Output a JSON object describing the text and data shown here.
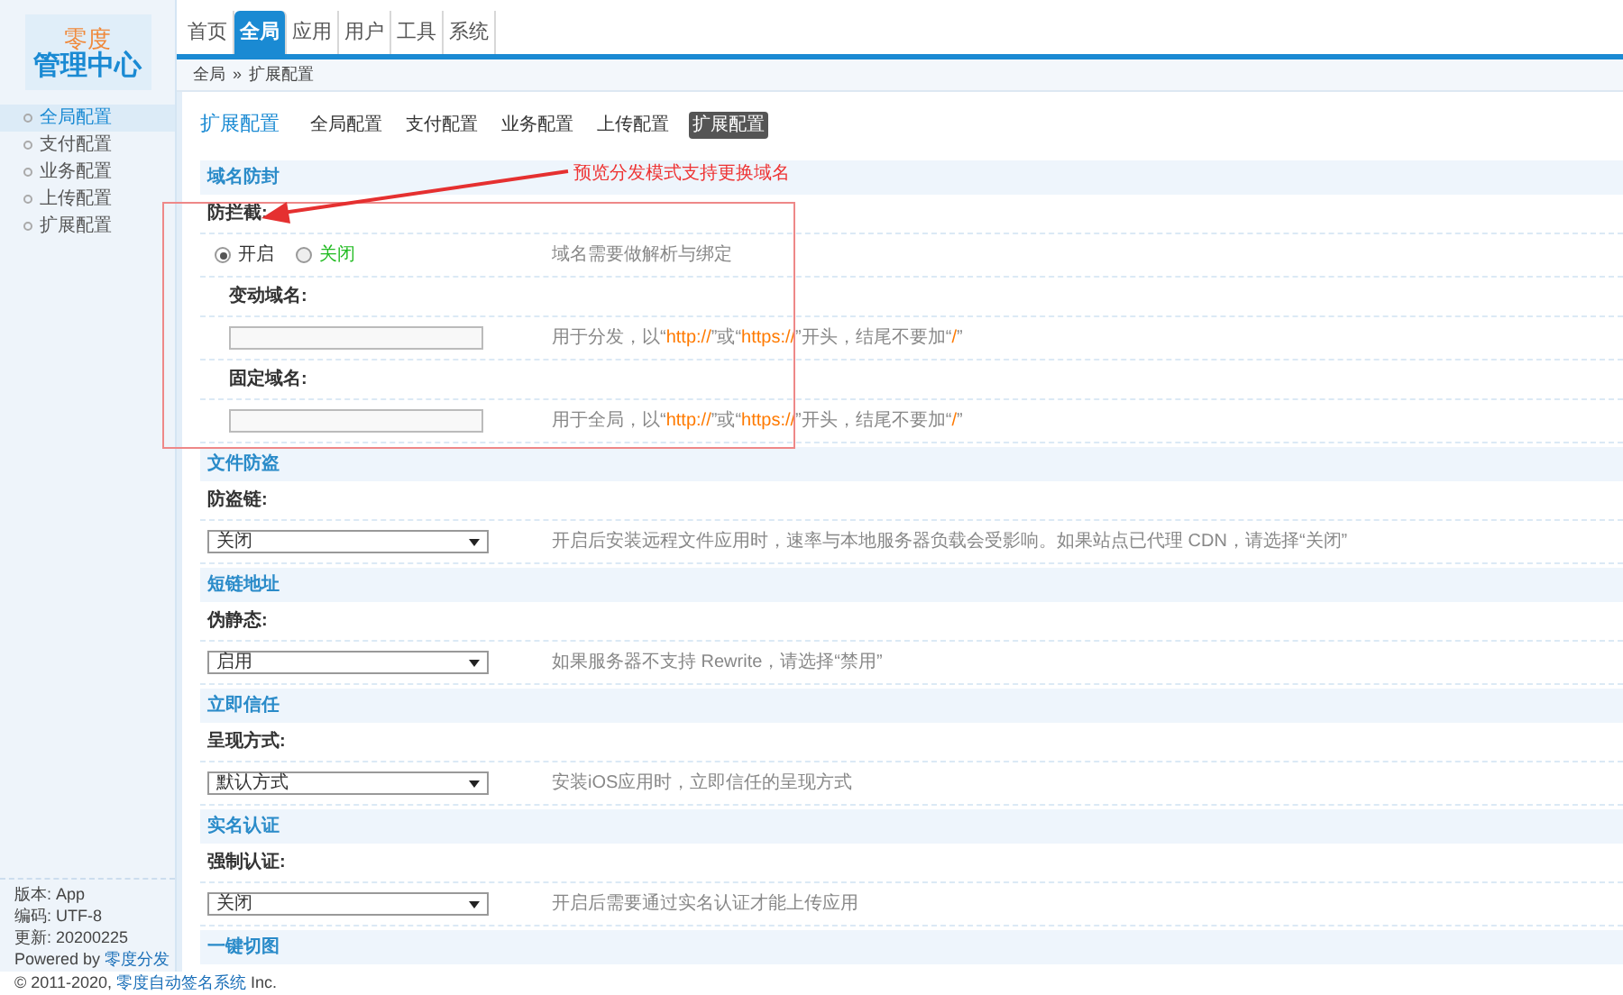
{
  "logo": {
    "top": "零度",
    "bottom": "管理中心"
  },
  "nav": [
    {
      "label": "首页",
      "selected": false
    },
    {
      "label": "全局",
      "selected": true
    },
    {
      "label": "应用",
      "selected": false
    },
    {
      "label": "用户",
      "selected": false
    },
    {
      "label": "工具",
      "selected": false
    },
    {
      "label": "系统",
      "selected": false
    }
  ],
  "breadcrumb": [
    "全局",
    "»",
    "扩展配置"
  ],
  "sidebar": {
    "items": [
      {
        "label": "全局配置",
        "selected": true
      },
      {
        "label": "支付配置",
        "selected": false
      },
      {
        "label": "业务配置",
        "selected": false
      },
      {
        "label": "上传配置",
        "selected": false
      },
      {
        "label": "扩展配置",
        "selected": false
      }
    ],
    "info": [
      "版本: App",
      "编码: UTF-8",
      "更新: 20200225"
    ],
    "powered": {
      "prefix": "Powered by ",
      "link": "零度分发"
    }
  },
  "copyright": {
    "prefix": "© 2011-2020, ",
    "link": "零度自动签名系统",
    "suffix": " Inc."
  },
  "page_title": "扩展配置",
  "tabs": [
    {
      "label": "全局配置",
      "selected": false
    },
    {
      "label": "支付配置",
      "selected": false
    },
    {
      "label": "业务配置",
      "selected": false
    },
    {
      "label": "上传配置",
      "selected": false
    },
    {
      "label": "扩展配置",
      "selected": true
    }
  ],
  "sections": [
    {
      "title": "域名防封",
      "fields": [
        {
          "label": "防拦截:",
          "kind": "radio",
          "options": [
            {
              "label": "开启",
              "selected": true,
              "color": "#333333"
            },
            {
              "label": "关闭",
              "selected": false,
              "color": "#22bb22"
            }
          ],
          "hint": [
            {
              "text": "域名需要做解析与绑定",
              "highlight": false
            }
          ],
          "children": [
            {
              "label": "变动域名:",
              "kind": "input",
              "hint": [
                {
                  "text": "用于分发，以“",
                  "highlight": false
                },
                {
                  "text": "http://",
                  "highlight": true
                },
                {
                  "text": "”或“",
                  "highlight": false
                },
                {
                  "text": "https://",
                  "highlight": true
                },
                {
                  "text": "”开头，结尾不要加“",
                  "highlight": false
                },
                {
                  "text": "/",
                  "highlight": true
                },
                {
                  "text": "”",
                  "highlight": false
                }
              ]
            },
            {
              "label": "固定域名:",
              "kind": "input",
              "hint": [
                {
                  "text": "用于全局，以“",
                  "highlight": false
                },
                {
                  "text": "http://",
                  "highlight": true
                },
                {
                  "text": "”或“",
                  "highlight": false
                },
                {
                  "text": "https://",
                  "highlight": true
                },
                {
                  "text": "”开头，结尾不要加“",
                  "highlight": false
                },
                {
                  "text": "/",
                  "highlight": true
                },
                {
                  "text": "”",
                  "highlight": false
                }
              ]
            }
          ]
        }
      ]
    },
    {
      "title": "文件防盗",
      "fields": [
        {
          "label": "防盗链:",
          "kind": "select",
          "value": "关闭",
          "hint": [
            {
              "text": "开启后安装远程文件应用时，速率与本地服务器负载会受影响。如果站点已代理 CDN，请选择“关闭”",
              "highlight": false
            }
          ]
        }
      ]
    },
    {
      "title": "短链地址",
      "fields": [
        {
          "label": "伪静态:",
          "kind": "select",
          "value": "启用",
          "hint": [
            {
              "text": "如果服务器不支持 Rewrite，请选择“禁用”",
              "highlight": false
            }
          ]
        }
      ]
    },
    {
      "title": "立即信任",
      "fields": [
        {
          "label": "呈现方式:",
          "kind": "select",
          "value": "默认方式",
          "hint": [
            {
              "text": "安装iOS应用时，立即信任的呈现方式",
              "highlight": false
            }
          ]
        }
      ]
    },
    {
      "title": "实名认证",
      "fields": [
        {
          "label": "强制认证:",
          "kind": "select",
          "value": "关闭",
          "hint": [
            {
              "text": "开启后需要通过实名认证才能上传应用",
              "highlight": false
            }
          ]
        }
      ]
    },
    {
      "title": "一键切图"
    }
  ],
  "annotation": {
    "text": "预览分发模式支持更换域名"
  }
}
